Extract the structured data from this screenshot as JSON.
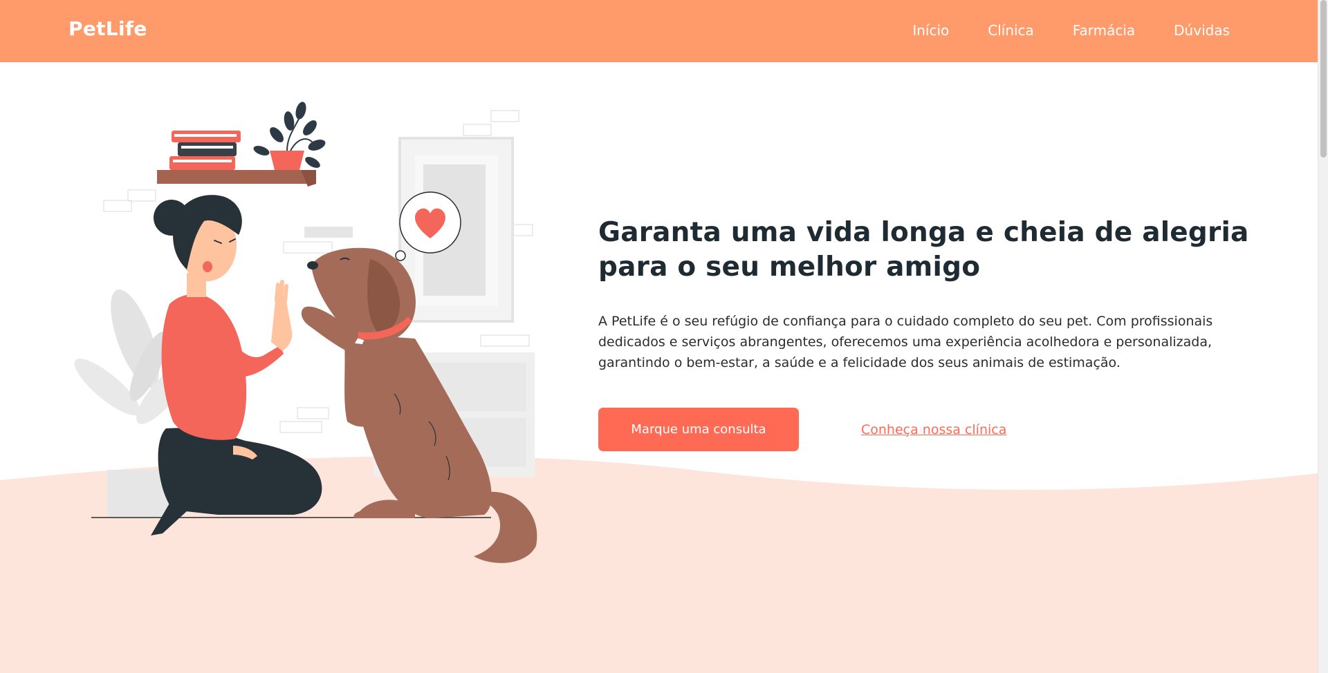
{
  "header": {
    "logo": "PetLife",
    "nav": [
      "Início",
      "Clínica",
      "Farmácia",
      "Dúvidas"
    ]
  },
  "hero": {
    "title_line1": "Garanta uma vida longa e cheia de alegria",
    "title_line2": "para o seu melhor amigo",
    "description": "A PetLife é o seu refúgio de confiança para o cuidado completo do seu pet. Com profissionais dedicados e serviços abrangentes, oferecemos uma experiência acolhedora e personalizada, garantindo o bem-estar, a saúde e a felicidade dos seus animais de estimação.",
    "primary_button": "Marque uma consulta",
    "secondary_link": "Conheça nossa clínica"
  },
  "illustration": {
    "name": "woman-giving-high-five-to-dog",
    "thought_icon": "heart-icon"
  },
  "colors": {
    "header_bg": "#ff9a6b",
    "accent": "#ff6a55",
    "wave_bg": "#fde5dc",
    "title": "#1f2b33"
  }
}
